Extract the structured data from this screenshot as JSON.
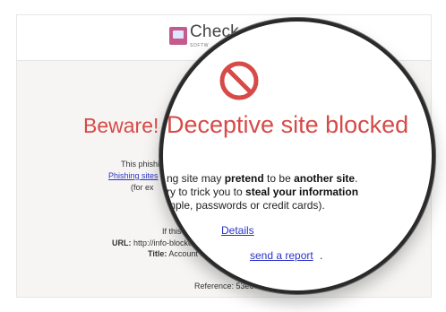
{
  "header": {
    "logo_name": "Check",
    "logo_sub": "SOFTW"
  },
  "background": {
    "beware": "Beware!",
    "line1": "This phishin",
    "phishing_link": "Phishing sites",
    "line3": "(for ex",
    "if_this": "If this is in",
    "url_label": "URL:",
    "url_value": "http://info-blocked",
    "title_label": "Title:",
    "title_value": "Account Rec",
    "reference_label": "Reference:",
    "reference_value": "53e85198"
  },
  "lens": {
    "headline": "Deceptive site blocked",
    "p1_a": "ng site may ",
    "p1_b": "pretend",
    "p1_c": " to be ",
    "p1_d": "another site",
    "p1_e": ".",
    "p2_a": "ry to trick you to ",
    "p2_b": "steal your information",
    "p3": "mple, passwords or credit cards).",
    "details": "Details",
    "send_report": "send a report",
    "send_report_tail": "."
  },
  "colors": {
    "accent_red": "#d64a48",
    "link_blue": "#2a33c8"
  }
}
